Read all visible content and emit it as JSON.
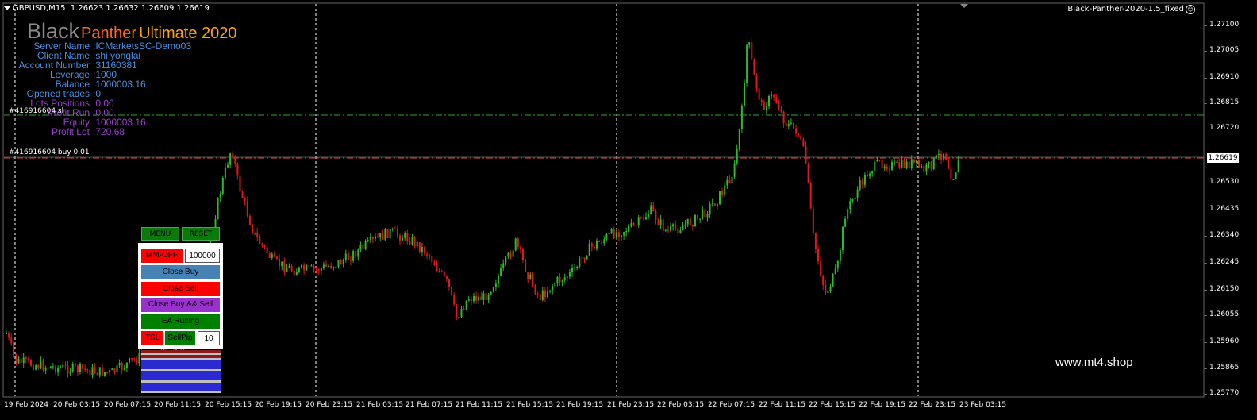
{
  "chart": {
    "symbol_text": "GBPUSD,M15  1.26623 1.26632 1.26609 1.26619",
    "ea_name": "Black-Panther-2020-1.5_fixed",
    "current_price": "1.26619",
    "watermark": "www.mt4.shop"
  },
  "brand": {
    "part1": "Black",
    "part2": "Panther",
    "part3": "Ultimate 2020"
  },
  "info_rows": [
    {
      "label": "Server Name",
      "value": ":ICMarketsSC-Demo03",
      "color": "#4a8fe0"
    },
    {
      "label": "Client Name",
      "value": ":shi yonglai",
      "color": "#4a8fe0"
    },
    {
      "label": "Account Number",
      "value": ":31160381",
      "color": "#4a8fe0"
    },
    {
      "label": "Leverage",
      "value": ":1000",
      "color": "#4a8fe0"
    },
    {
      "label": "Balance",
      "value": ":1000003.16",
      "color": "#4a8fe0"
    },
    {
      "label": "Opened trades",
      "value": ":0",
      "color": "#4a8fe0"
    },
    {
      "label": "Lots Positions",
      "value": ":0.00",
      "color": "#9b3fd1"
    },
    {
      "label": "Profit Run",
      "value": ":0.00",
      "color": "#9b3fd1"
    },
    {
      "label": "Equity",
      "value": ":1000003.16",
      "color": "#9b3fd1"
    },
    {
      "label": "Profit Lot",
      "value": ":720.68",
      "color": "#9b3fd1"
    }
  ],
  "order_lines": [
    {
      "label": "#416916604 sl",
      "color": "#2fa32f"
    },
    {
      "label": "#416916604 buy 0.01",
      "color": "#d04040"
    }
  ],
  "panel": {
    "menu": "MENU",
    "reset": "RESET",
    "mm_off": "MM-OFF",
    "mm_value": "100000",
    "close_buy": "Close Buy",
    "close_sell": "Close Sell",
    "close_both": "Close Buy && Sell",
    "ea_running": "EA Runing",
    "tsl": "TSL",
    "sellpip": "SellPip",
    "sellpip_value": "10"
  },
  "price_axis": [
    "1.27100",
    "1.27005",
    "1.26910",
    "1.26815",
    "1.26720",
    "1.26530",
    "1.26435",
    "1.26340",
    "1.26245",
    "1.26150",
    "1.26055",
    "1.25960",
    "1.25865",
    "1.25770"
  ],
  "time_axis": [
    "19 Feb 2024",
    "20 Feb 03:15",
    "20 Feb 07:15",
    "20 Feb 11:15",
    "20 Feb 15:15",
    "20 Feb 19:15",
    "20 Feb 23:15",
    "21 Feb 03:15",
    "21 Feb 07:15",
    "21 Feb 11:15",
    "21 Feb 15:15",
    "21 Feb 19:15",
    "21 Feb 23:15",
    "22 Feb 03:15",
    "22 Feb 07:15",
    "22 Feb 11:15",
    "22 Feb 15:15",
    "22 Feb 19:15",
    "22 Feb 23:15",
    "23 Feb 03:15"
  ],
  "colors": {
    "bull": "#2eb82e",
    "bear": "#e01818",
    "grid": "#ffffff",
    "sl_line": "#2fa32f",
    "entry_line": "#d04040"
  }
}
